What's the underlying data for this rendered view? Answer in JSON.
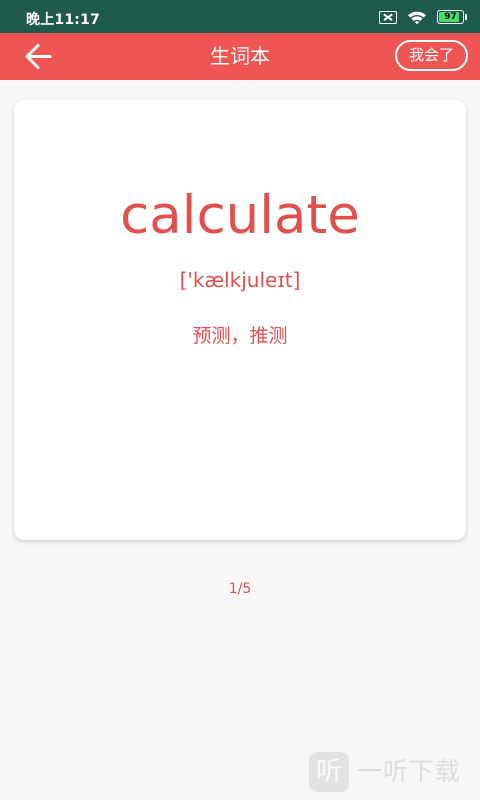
{
  "status_bar": {
    "time": "晚上11:17",
    "battery_level": "97"
  },
  "header": {
    "title": "生词本",
    "action_label": "我会了",
    "back_icon": "arrow-left-icon",
    "bg_color": "#ef5552"
  },
  "card": {
    "word": "calculate",
    "phonetic": "['kælkjuleɪt]",
    "meaning": "预测，推测",
    "text_color": "#e24f4c"
  },
  "pagination": {
    "counter": "1/5"
  },
  "watermark": {
    "logo_glyph": "听",
    "text": "一听下载"
  }
}
